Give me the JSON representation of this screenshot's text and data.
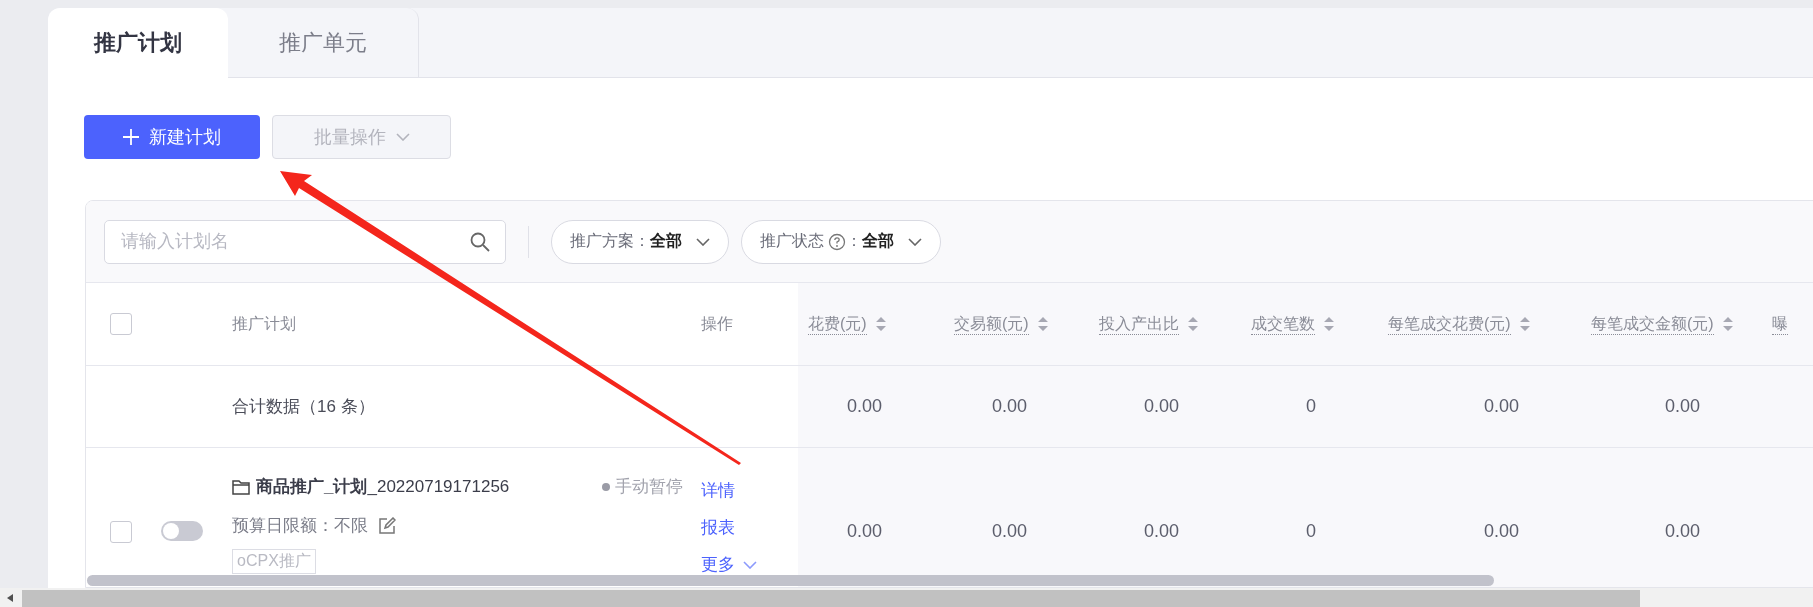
{
  "tabs": [
    {
      "label": "推广计划",
      "selected": true
    },
    {
      "label": "推广单元",
      "selected": false
    }
  ],
  "toolbar": {
    "buttons": [
      {
        "kind": "primary",
        "label": "新建计划",
        "disabled": false
      },
      {
        "kind": "dropdown",
        "label": "批量操作",
        "disabled": true
      }
    ]
  },
  "search": {
    "placeholder": "请输入计划名"
  },
  "filters": [
    {
      "label": "推广方案",
      "help": false,
      "separator": "：",
      "value": "全部"
    },
    {
      "label": "推广状态",
      "help": true,
      "separator": "：",
      "value": "全部"
    }
  ],
  "table": {
    "select_all": {
      "checked": false
    },
    "columns": [
      {
        "label": "推广计划",
        "kind": "text"
      },
      {
        "label": "操作",
        "kind": "text"
      },
      {
        "label": "花费(元)",
        "kind": "metric",
        "sortable": true
      },
      {
        "label": "交易额(元)",
        "kind": "metric",
        "sortable": true
      },
      {
        "label": "投入产出比",
        "kind": "metric",
        "sortable": true
      },
      {
        "label": "成交笔数",
        "kind": "metric",
        "sortable": true
      },
      {
        "label": "每笔成交花费(元)",
        "kind": "metric",
        "sortable": true
      },
      {
        "label": "每笔成交金额(元)",
        "kind": "metric",
        "sortable": true
      },
      {
        "label": "曝",
        "kind": "metric"
      }
    ],
    "summary": {
      "label": "合计数据（16 条）",
      "values": [
        "0.00",
        "0.00",
        "0.00",
        "0",
        "0.00",
        "0.00"
      ]
    },
    "rows": [
      {
        "checked": false,
        "on": false,
        "name": "**商品推广_计划**_20220719171256",
        "status": {
          "label": "手动暂停",
          "color": "#9a9ba6"
        },
        "budget": "预算日限额：不限",
        "tag": "oCPX推广",
        "actions": [
          "详情",
          "报表",
          "更多"
        ],
        "values": [
          "0.00",
          "0.00",
          "0.00",
          "0",
          "0.00",
          "0.00"
        ]
      }
    ]
  }
}
